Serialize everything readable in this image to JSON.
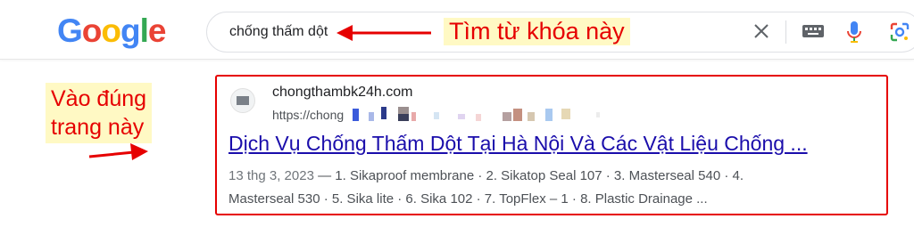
{
  "logo": {
    "text": "Google",
    "letters": [
      "G",
      "o",
      "o",
      "g",
      "l",
      "e"
    ],
    "colors": [
      "#4285F4",
      "#EA4335",
      "#FBBC05",
      "#4285F4",
      "#34A853",
      "#EA4335"
    ]
  },
  "search": {
    "query": "chống thấm dột"
  },
  "annotations": {
    "top": "Tìm từ khóa này",
    "left_line1": "Vào đúng",
    "left_line2": "trang này",
    "color": "#e60000",
    "highlight": "#fff9c4"
  },
  "icons": [
    "close-icon",
    "keyboard-icon",
    "microphone-icon",
    "google-lens-icon"
  ],
  "result": {
    "site_name": "chongthambk24h.com",
    "url_prefix": "https://chong",
    "title": "Dịch Vụ Chống Thấm Dột Tại Hà Nội Và Các Vật Liệu Chống ...",
    "date": "13 thg 3, 2023",
    "snippet_line1": "— 1. Sikaproof membrane · 2. Sikatop Seal 107 · 3. Masterseal 540 · 4.",
    "snippet_line2": "Masterseal 530 · 5. Sika lite · 6. Sika 102 · 7. TopFlex – 1 · 8. Plastic Drainage ..."
  }
}
